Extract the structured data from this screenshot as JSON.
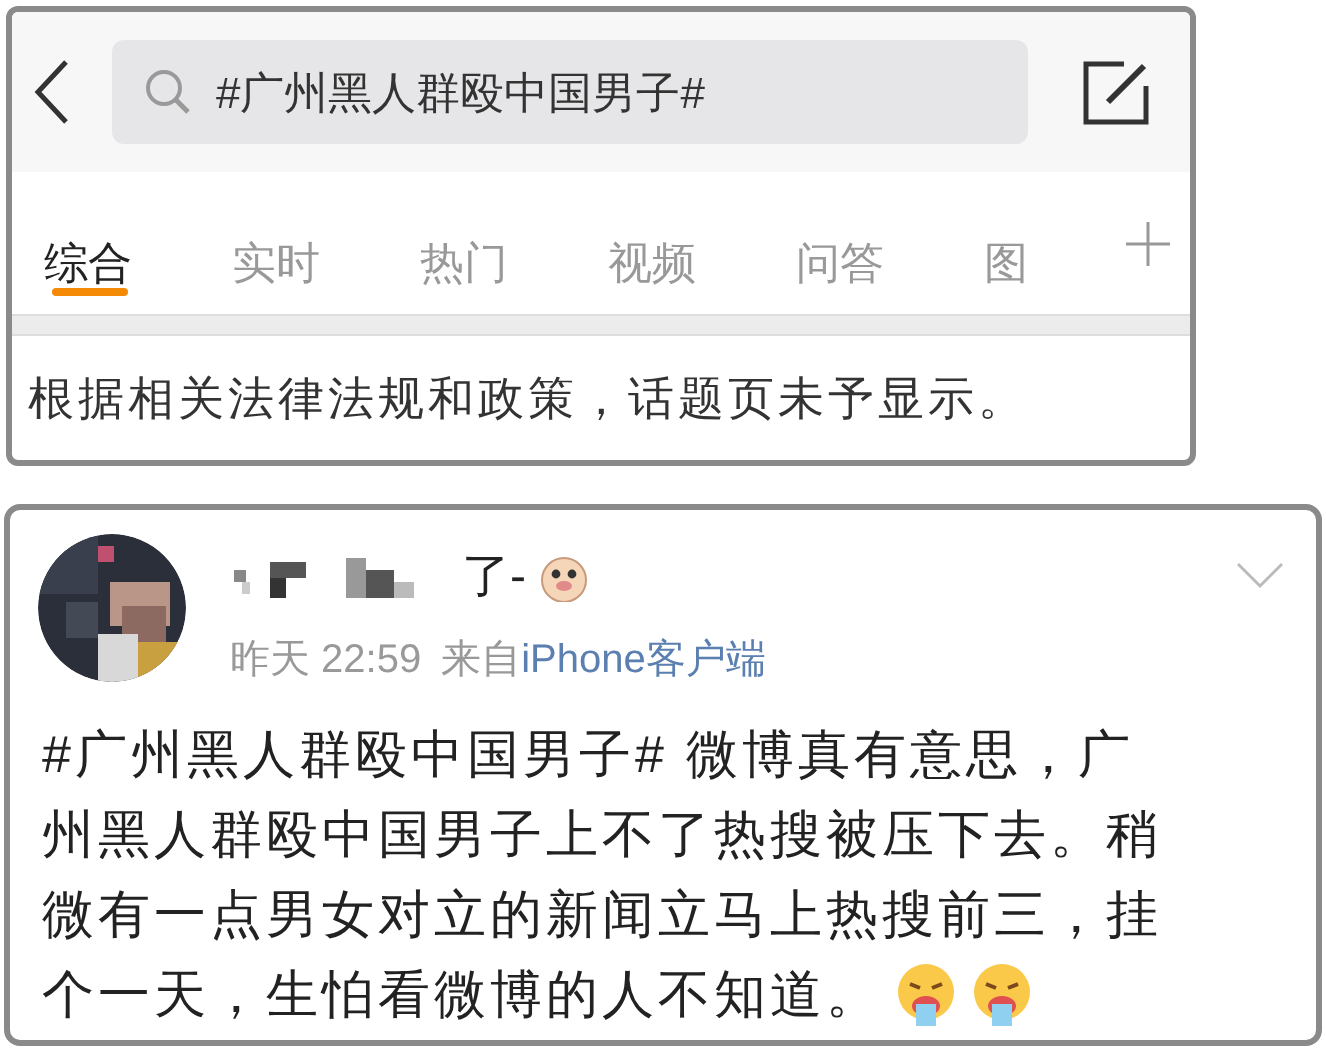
{
  "search": {
    "value": "#广州黑人群殴中国男子#"
  },
  "tabs": [
    {
      "label": "综合",
      "selected": true
    },
    {
      "label": "实时",
      "selected": false
    },
    {
      "label": "热门",
      "selected": false
    },
    {
      "label": "视频",
      "selected": false
    },
    {
      "label": "问答",
      "selected": false
    },
    {
      "label": "图",
      "selected": false
    }
  ],
  "notice": "根据相关法律法规和政策，话题页未予显示。",
  "post": {
    "username": "了-",
    "time": "昨天 22:59",
    "source_prefix": "来自",
    "source": "iPhone客户端",
    "text_lines": [
      "#广州黑人群殴中国男子# 微博真有意思，广",
      "州黑人群殴中国男子上不了热搜被压下去。稍",
      "微有一点男女对立的新闻立马上热搜前三，挂",
      "个一天，生怕看微博的人不知道。"
    ]
  }
}
